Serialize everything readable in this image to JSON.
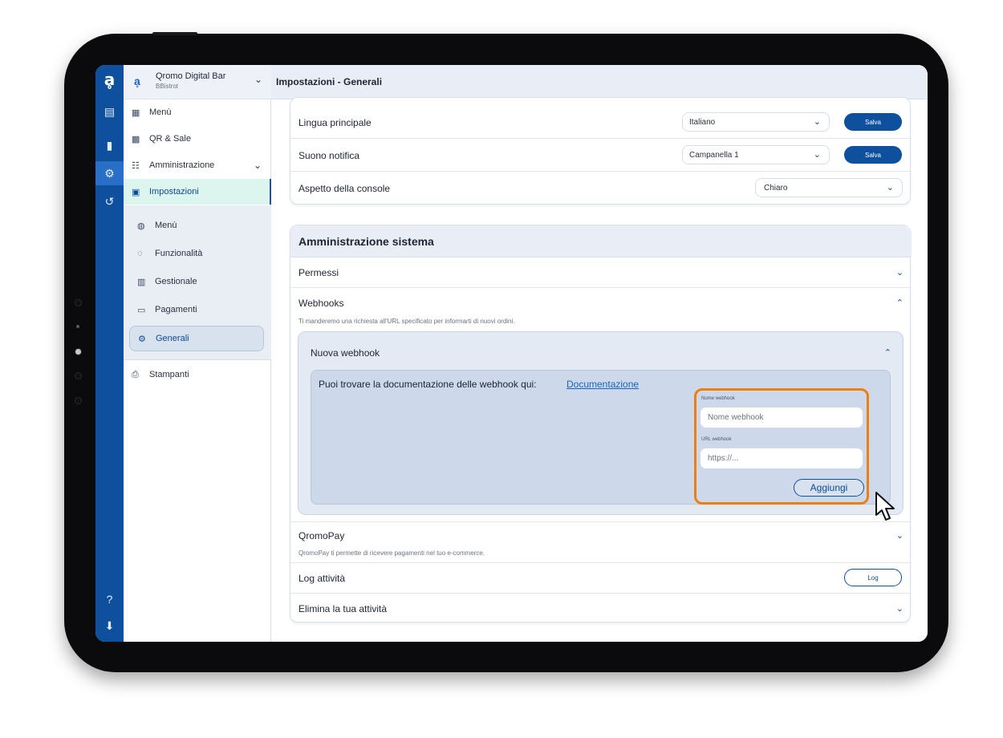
{
  "topbar": {
    "title": "Impostazioni - Generali"
  },
  "org": {
    "name": "Qromo Digital Bar",
    "sub": "BBistrot"
  },
  "sidebar": {
    "items": [
      {
        "label": "Menù",
        "icon": "menu-book-icon"
      },
      {
        "label": "QR & Sale",
        "icon": "qr-code-icon"
      },
      {
        "label": "Amministrazione",
        "icon": "admin-icon"
      },
      {
        "label": "Impostazioni",
        "icon": "settings-box-icon"
      }
    ],
    "subitems": [
      {
        "label": "Menù",
        "icon": "menu-icon"
      },
      {
        "label": "Funzionalità",
        "icon": "features-icon"
      },
      {
        "label": "Gestionale",
        "icon": "management-icon"
      },
      {
        "label": "Pagamenti",
        "icon": "payments-icon"
      },
      {
        "label": "Generali",
        "icon": "gear-icon"
      }
    ],
    "printers": {
      "label": "Stampanti",
      "icon": "printer-icon"
    }
  },
  "general": {
    "lingua": {
      "label": "Lingua principale",
      "value": "Italiano",
      "save": "Salva"
    },
    "suono": {
      "label": "Suono notifica",
      "value": "Campanella 1",
      "save": "Salva"
    },
    "aspetto": {
      "label": "Aspetto della console",
      "value": "Chiaro"
    }
  },
  "admin": {
    "title": "Amministrazione sistema",
    "permessi": "Permessi",
    "webhooks": {
      "label": "Webhooks",
      "desc": "Ti manderemo una richiesta all'URL specificato per informarti di nuovi ordini.",
      "new_title": "Nuova webhook",
      "doc_text": "Puoi trovare la documentazione delle webhook qui:",
      "doc_link": "Documentazione",
      "name_label": "Nome webhook",
      "name_placeholder": "Nome webhook",
      "url_label": "URL webhook",
      "url_placeholder": "https://...",
      "add_button": "Aggiungi"
    },
    "qromopay": {
      "label": "QromoPay",
      "desc": "QromoPay ti permette di ricevere pagamenti nel tuo e-commerce."
    },
    "log": {
      "label": "Log attività",
      "button": "Log"
    },
    "delete": {
      "label": "Elimina la tua attività"
    }
  },
  "colors": {
    "brand": "#0e4f9e",
    "highlight": "#f07d10",
    "selected_nav": "#dcf5ef"
  }
}
